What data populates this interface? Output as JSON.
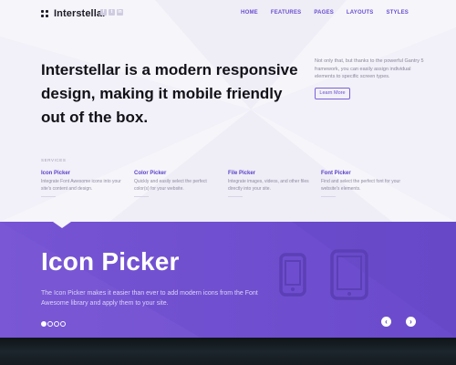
{
  "header": {
    "logo_text": "Interstellar",
    "socials": [
      {
        "icon": "facebook-icon",
        "glyph": "f"
      },
      {
        "icon": "twitter-icon",
        "glyph": "t"
      },
      {
        "icon": "linkedin-icon",
        "glyph": "in"
      }
    ],
    "nav": [
      "HOME",
      "FEATURES",
      "PAGES",
      "LAYOUTS",
      "STYLES"
    ]
  },
  "hero": {
    "headline": "Interstellar is a modern responsive design, making it mobile friendly out of the box.",
    "side_text": "Not only that, but thanks to the powerful Gantry 5 framework, you can easily assign individual elements to specific screen types.",
    "button_label": "Learn More"
  },
  "services": {
    "label": "SERVICES",
    "items": [
      {
        "title": "Icon Picker",
        "desc": "Integrate Font Awesome icons into your site's content and design."
      },
      {
        "title": "Color Picker",
        "desc": "Quickly and easily select the perfect color(s) for your website."
      },
      {
        "title": "File Picker",
        "desc": "Integrate images, videos, and other files directly into your site."
      },
      {
        "title": "Font Picker",
        "desc": "Find and select the perfect font for your website's elements."
      }
    ]
  },
  "slider": {
    "title": "Icon Picker",
    "desc": "The Icon Picker makes it easier than ever to add modern icons from the Font Awesome library and apply them to your site.",
    "slide_count": 4,
    "active_slide": 1,
    "prev_icon": "chevron-left-icon",
    "next_icon": "chevron-right-icon",
    "prev_glyph": "‹",
    "next_glyph": "›"
  },
  "colors": {
    "accent": "#6a4fd0",
    "slider_bg": "#7451d1",
    "page_bg": "#f6f5fa",
    "dark_strip": "#151b20"
  }
}
